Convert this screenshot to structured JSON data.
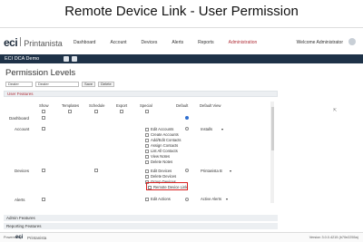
{
  "slide_title": "Remote Device Link - User Permission",
  "header": {
    "logo_eci": "eci",
    "logo_product": "Printanista",
    "nav": [
      "Dashboard",
      "Account",
      "Devices",
      "Alerts",
      "Reports",
      "Administration"
    ],
    "active_nav": "Administration",
    "welcome": "Welcome Administrator"
  },
  "tenant_bar": {
    "name": "ECI DCA Demo",
    "icons": [
      "building-icon",
      "download-icon"
    ]
  },
  "page": {
    "title": "Permission Levels",
    "filters": {
      "type_value": "Dealer",
      "name_value": "Dealer",
      "save_label": "Save",
      "delete_label": "Delete"
    }
  },
  "sections": {
    "user_features": "User Features",
    "admin_features": "Admin Features",
    "reporting_features": "Reporting Features"
  },
  "columns": [
    "Show",
    "Templates",
    "Schedule",
    "Export",
    "Special",
    "Default",
    "Default View"
  ],
  "rows": {
    "dashboard": "Dashboard",
    "account": "Account",
    "devices": "Devices",
    "alerts": "Alerts"
  },
  "account_permissions": [
    "Edit Accounts",
    "Create Accounts",
    "Add/Edit Contacts",
    "Assign Contacts",
    "List All Contacts",
    "View Notes",
    "Delete Notes"
  ],
  "account_default_view": "Installs",
  "devices_permissions": [
    "Edit Devices",
    "Delete Devices",
    "Group Devices",
    "Remote Device Link"
  ],
  "devices_default_view": "Printanista B",
  "alerts_permissions": [
    "Edit Actions"
  ],
  "alerts_default_view": "Active Alerts",
  "footer": {
    "powered_by": "Powered by",
    "logo_eci": "eci",
    "product": "Printanista",
    "version": "Version 3.0.0.4215 (b70e2255a)"
  },
  "colors": {
    "navy": "#1e3248",
    "accent_red": "#b0303a",
    "highlight_red": "#d92020",
    "radio_blue": "#2f6fd0"
  }
}
